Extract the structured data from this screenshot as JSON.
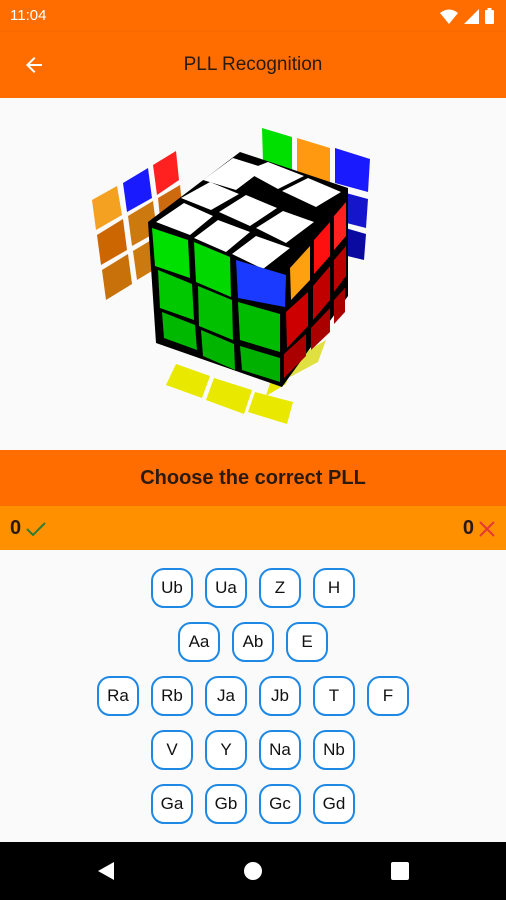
{
  "status_bar": {
    "time": "11:04"
  },
  "app_bar": {
    "title": "PLL Recognition",
    "back_icon": "arrow-back-icon"
  },
  "prompt": {
    "text": "Choose the correct PLL"
  },
  "score": {
    "correct": "0",
    "wrong": "0",
    "correct_icon": "check-icon",
    "wrong_icon": "close-icon"
  },
  "answers": {
    "row1": [
      "Ub",
      "Ua",
      "Z",
      "H"
    ],
    "row2": [
      "Aa",
      "Ab",
      "E"
    ],
    "row3": [
      "Ra",
      "Rb",
      "Ja",
      "Jb",
      "T",
      "F"
    ],
    "row4": [
      "V",
      "Y",
      "Na",
      "Nb"
    ],
    "row5": [
      "Ga",
      "Gb",
      "Gc",
      "Gd"
    ]
  },
  "colors": {
    "accent": "#ff6d00",
    "score_bar": "#ff9100",
    "button_border": "#1e88e5",
    "correct": "#2e7d32",
    "wrong": "#e53935"
  }
}
